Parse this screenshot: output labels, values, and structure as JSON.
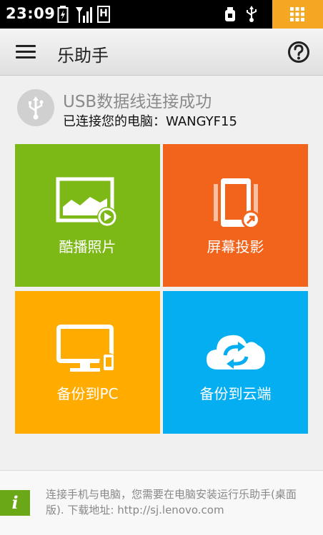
{
  "status_bar": {
    "time": "23:09",
    "icons": [
      "battery-icon",
      "signal-icon",
      "h-network-icon",
      "usb-debug-icon",
      "usb-icon",
      "apps-grid-icon"
    ],
    "network_label": "H",
    "apps_color": "#f5a623"
  },
  "app_bar": {
    "title": "乐助手",
    "menu_icon": "hamburger-icon",
    "help_icon": "help-icon"
  },
  "connection": {
    "title": "USB数据线连接成功",
    "subtitle": "已连接您的电脑：WANGYF15"
  },
  "tiles": [
    {
      "label": "酷播照片",
      "icon": "photo-play-icon",
      "color": "#7cb916"
    },
    {
      "label": "屏幕投影",
      "icon": "screen-projection-icon",
      "color": "#f2631c"
    },
    {
      "label": "备份到PC",
      "icon": "backup-pc-icon",
      "color": "#ffab00"
    },
    {
      "label": "备份到云端",
      "icon": "cloud-sync-icon",
      "color": "#04aef1"
    }
  ],
  "footer": {
    "badge": "i",
    "text": "连接手机与电脑，您需要在电脑安装运行乐助手(桌面版). 下载地址: http://sj.lenovo.com"
  }
}
